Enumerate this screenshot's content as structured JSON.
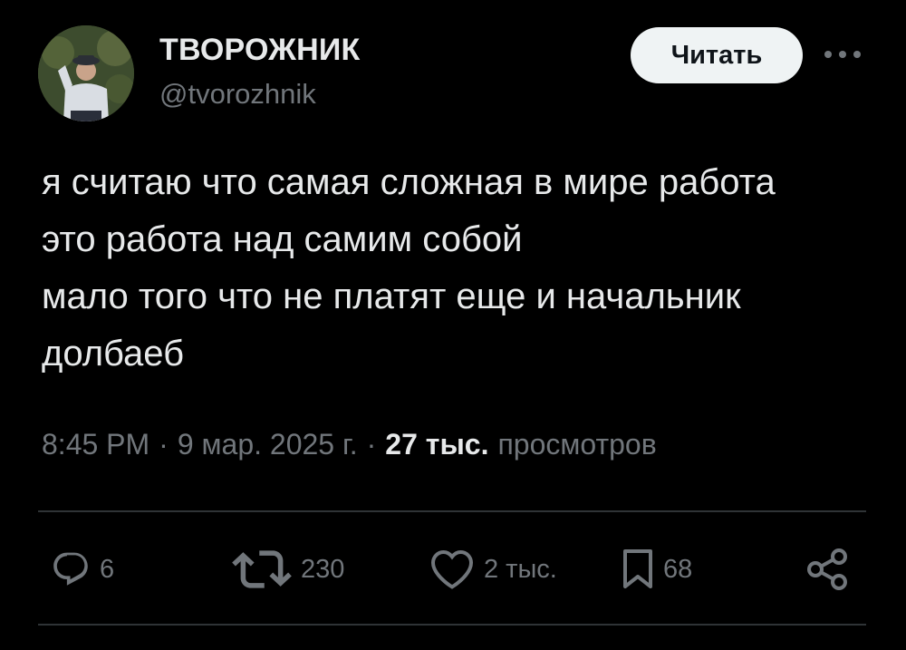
{
  "author": {
    "display_name": "ТВОРОЖНИК",
    "handle": "@tvorozhnik",
    "avatar_icon": "user-avatar"
  },
  "header": {
    "follow_label": "Читать",
    "more_icon": "more-horizontal-icon"
  },
  "tweet": {
    "lines": [
      "я считаю что самая сложная в мире работа",
      "это работа над самим собой",
      "мало того что не платят еще и начальник",
      "долбаеб"
    ]
  },
  "meta": {
    "time": "8:45 PM",
    "separator": "·",
    "date": "9 мар. 2025 г.",
    "views_count": "27 тыс.",
    "views_label": "просмотров"
  },
  "actions": {
    "replies": {
      "icon": "reply-icon",
      "count": "6"
    },
    "retweets": {
      "icon": "retweet-icon",
      "count": "230"
    },
    "likes": {
      "icon": "heart-icon",
      "count": "2 тыс."
    },
    "bookmarks": {
      "icon": "bookmark-icon",
      "count": "68"
    },
    "share": {
      "icon": "share-icon"
    }
  },
  "colors": {
    "background": "#000000",
    "text_primary": "#e7e9ea",
    "text_secondary": "#71767b",
    "divider": "#2f3336",
    "follow_button_bg": "#eff3f4",
    "follow_button_text": "#0f1419"
  }
}
